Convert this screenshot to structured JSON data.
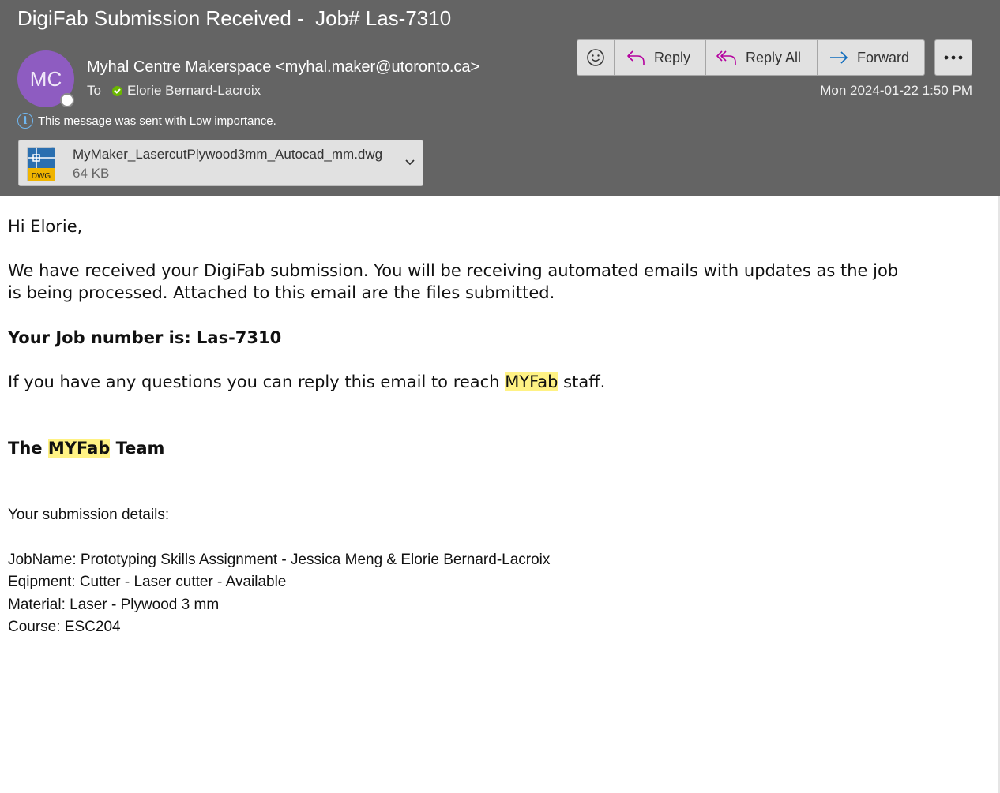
{
  "email": {
    "subject": "DigiFab Submission Received -  Job# Las-7310",
    "avatar_initials": "MC",
    "sender": "Myhal Centre Makerspace <myhal.maker@utoronto.ca>",
    "to_label": "To",
    "recipient": "Elorie Bernard-Lacroix",
    "importance_notice": "This message was sent with Low importance.",
    "date": "Mon 2024-01-22 1:50 PM"
  },
  "attachment": {
    "name": "MyMaker_LasercutPlywood3mm_Autocad_mm.dwg",
    "size": "64 KB",
    "badge": "DWG",
    "icon": "dwg-file-icon"
  },
  "toolbar": {
    "emoji_icon": "smiley-icon",
    "reply": "Reply",
    "reply_all": "Reply All",
    "forward": "Forward",
    "more_icon": "more-icon"
  },
  "body": {
    "greeting": "Hi Elorie,",
    "para1_line1": "We have received your DigiFab submission. You will be receiving automated emails with updates as the job",
    "para1_line2": "is being processed. Attached to this email are the files submitted.",
    "job_line": "Your Job number is: Las-7310",
    "questions_before": "If you have any questions you can reply this email to reach ",
    "questions_highlight": "MYFab",
    "questions_after": " staff.",
    "sign_before": "The ",
    "sign_highlight": "MYFab",
    "sign_after": " Team"
  },
  "details": {
    "heading": "Your submission details:",
    "job_name": "JobName: Prototyping Skills Assignment - Jessica Meng & Elorie Bernard-Lacroix",
    "equipment": "Eqipment: Cutter - Laser cutter - Available",
    "material": "Material: Laser - Plywood 3 mm",
    "course": "Course: ESC204"
  },
  "colors": {
    "header_bg": "#646464",
    "avatar_bg": "#8e5cc1",
    "highlight": "#fff284",
    "reply_icon": "#b4009e",
    "forward_icon": "#0f6cbd"
  }
}
